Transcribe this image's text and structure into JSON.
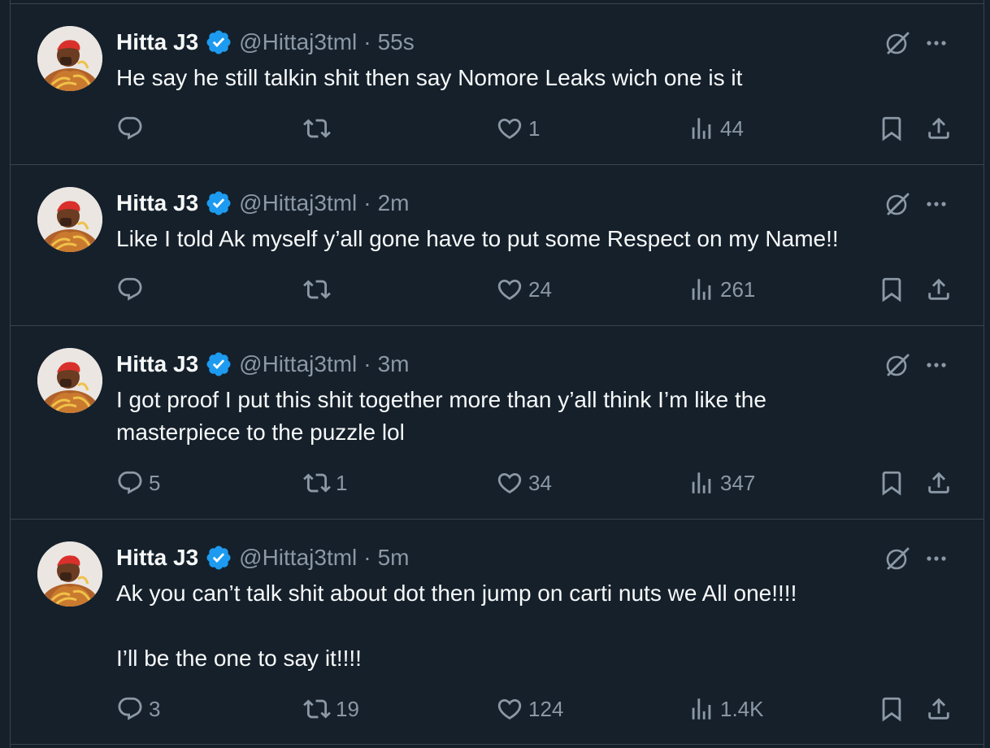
{
  "colors": {
    "background": "#15202b",
    "border": "#38444d",
    "primary_text": "#f7f9f9",
    "secondary_text": "#8b98a5",
    "verified_blue": "#1d9bf0"
  },
  "icons": {
    "reply": "speech-bubble-icon",
    "repost": "repost-arrows-icon",
    "like": "heart-icon",
    "views": "bar-chart-icon",
    "bookmark": "bookmark-icon",
    "share": "share-icon",
    "grok": "grok-slash-icon",
    "more": "more-dots-icon",
    "verified": "verified-badge-icon"
  },
  "tweets": [
    {
      "name": "Hitta J3",
      "handle": "@Hittaj3tml",
      "separator": "·",
      "time": "55s",
      "text": "He say he still talkin shit then say Nomore Leaks wich one is it",
      "replies": "",
      "reposts": "",
      "likes": "1",
      "views": "44"
    },
    {
      "name": "Hitta J3",
      "handle": "@Hittaj3tml",
      "separator": "·",
      "time": "2m",
      "text": "Like I told Ak myself y’all gone have to put some Respect on my Name!!",
      "replies": "",
      "reposts": "",
      "likes": "24",
      "views": "261"
    },
    {
      "name": "Hitta J3",
      "handle": "@Hittaj3tml",
      "separator": "·",
      "time": "3m",
      "text": "I got proof I put this shit together more than y’all think I’m like the\nmasterpiece to the puzzle lol",
      "replies": "5",
      "reposts": "1",
      "likes": "34",
      "views": "347"
    },
    {
      "name": "Hitta J3",
      "handle": "@Hittaj3tml",
      "separator": "·",
      "time": "5m",
      "text": "Ak you can’t talk shit about dot then jump on carti nuts we All one!!!!\n\nI’ll be the one to say it!!!!",
      "replies": "3",
      "reposts": "19",
      "likes": "124",
      "views": "1.4K"
    }
  ]
}
